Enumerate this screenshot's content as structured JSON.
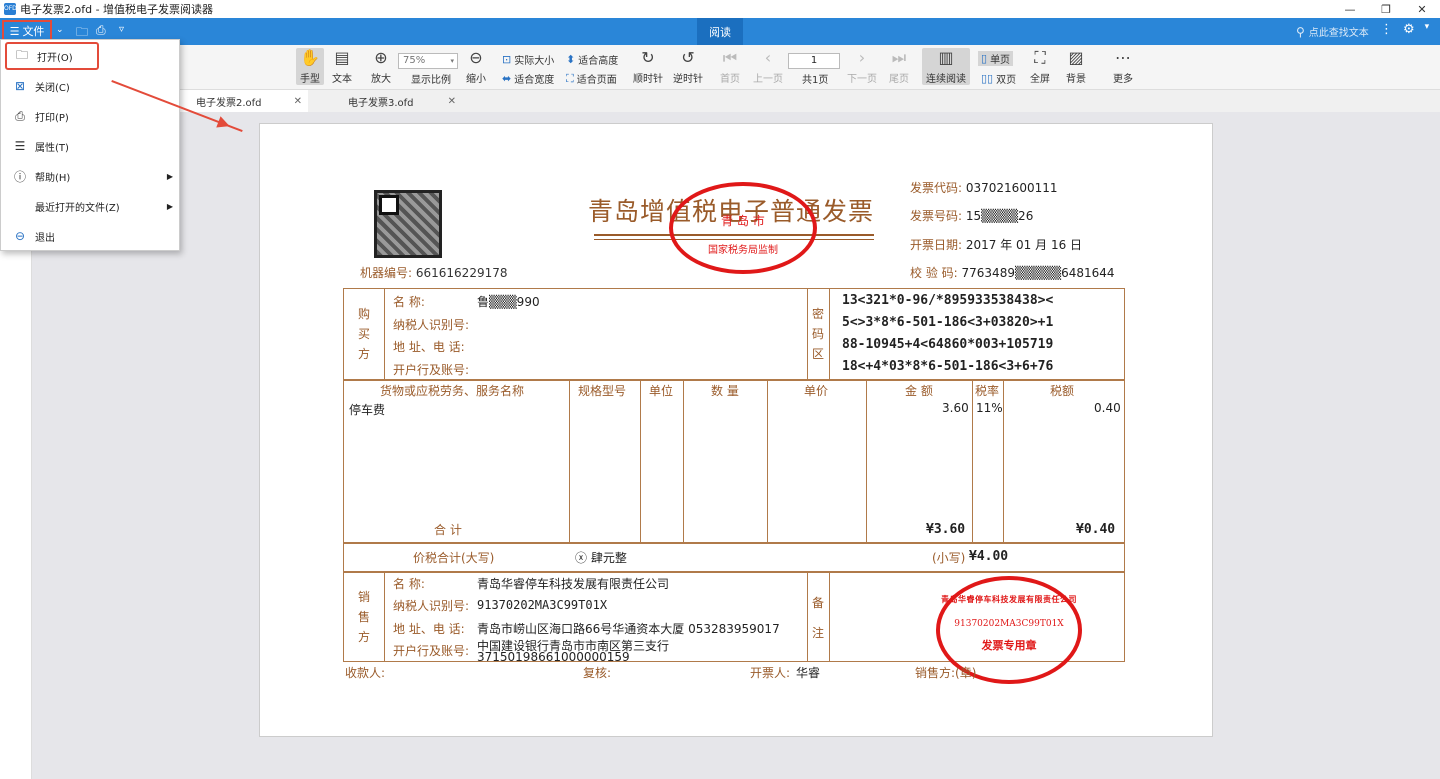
{
  "window": {
    "title": "电子发票2.ofd - 增值税电子发票阅读器",
    "app_icon": "ofd-icon"
  },
  "menubar": {
    "file": "文件",
    "mode_tab": "阅读",
    "search_placeholder": "点此查找文本"
  },
  "toolbar": {
    "hand": "手型",
    "text": "文本",
    "zoom_in": "放大",
    "zoom_value": "75%",
    "zoom_label": "显示比例",
    "zoom_out": "缩小",
    "actual_size": "实际大小",
    "fit_height": "适合高度",
    "fit_width": "适合宽度",
    "fit_page": "适合页面",
    "rotate_cw": "顺时针",
    "rotate_ccw": "逆时针",
    "first": "首页",
    "prev": "上一页",
    "page_value": "1",
    "total_pages": "共1页",
    "next": "下一页",
    "last": "尾页",
    "continuous": "连续阅读",
    "single": "单页",
    "double": "双页",
    "fullscreen": "全屏",
    "background": "背景",
    "more": "更多"
  },
  "tabs": [
    {
      "label": "电子发票2.ofd",
      "active": true
    },
    {
      "label": "电子发票3.ofd",
      "active": false
    }
  ],
  "file_menu": [
    {
      "label": "打开(O)",
      "icon": "folder-icon"
    },
    {
      "label": "关闭(C)",
      "icon": "close-icon"
    },
    {
      "label": "打印(P)",
      "icon": "printer-icon"
    },
    {
      "label": "属性(T)",
      "icon": "properties-icon"
    },
    {
      "label": "帮助(H)",
      "icon": "help-icon",
      "submenu": true
    },
    {
      "label": "最近打开的文件(Z)",
      "icon": "",
      "submenu": true
    },
    {
      "label": "退出",
      "icon": "exit-icon"
    }
  ],
  "invoice": {
    "title": "青岛增值税电子普通发票",
    "stamp_top": {
      "line1": "青 岛 市",
      "line2": "国家税务局监制"
    },
    "machine_label": "机器编号:",
    "machine_no": "661616229178",
    "code_label": "发票代码:",
    "code": "037021600111",
    "number_label": "发票号码:",
    "number": "15▒▒▒▒26",
    "date_label": "开票日期:",
    "date": "2017 年 01 月 16 日",
    "check_label": "校 验 码:",
    "check": "7763489▒▒▒▒▒6481644",
    "buyer_side": "购买方",
    "buyer_name_label": "名            称:",
    "buyer_name": "鲁▒▒▒990",
    "buyer_tax_label": "纳税人识别号:",
    "buyer_addr_label": "地 址、电 话:",
    "buyer_bank_label": "开户行及账号:",
    "cipher_side": "密码区",
    "cipher": [
      "13<321*0-96/*895933538438><",
      "5<>3*8*6-501-186<3+03820>+1",
      "88-10945+4<64860*003+105719",
      "18<+4*03*8*6-501-186<3+6+76"
    ],
    "headers": [
      "货物或应税劳务、服务名称",
      "规格型号",
      "单位",
      "数 量",
      "单价",
      "金 额",
      "税率",
      "税额"
    ],
    "item": {
      "name": "停车费",
      "amount": "3.60",
      "rate": "11%",
      "tax": "0.40"
    },
    "total_label": "合    计",
    "total_amount": "¥3.60",
    "total_tax": "¥0.40",
    "grand_label": "价税合计(大写)",
    "grand_upper": "肆元整",
    "grand_small_label": "(小写)",
    "grand_small": "¥4.00",
    "seller_side": "销售方",
    "seller_name_label": "名            称:",
    "seller_name": "青岛华睿停车科技发展有限责任公司",
    "seller_tax_label": "纳税人识别号:",
    "seller_tax": "91370202MA3C99T01X",
    "seller_addr_label": "地 址、电 话:",
    "seller_addr": "青岛市崂山区海口路66号华通资本大厦 053283959017",
    "seller_bank_label": "开户行及账号:",
    "seller_bank1": "中国建设银行青岛市市南区第三支行",
    "seller_bank2": "37150198661000000159",
    "remark_side": "备注",
    "payee_label": "收款人:",
    "review_label": "复核:",
    "drawer_label": "开票人:",
    "drawer": "华睿",
    "seller_label": "销售方:(章)",
    "stamp_seller": {
      "ring": "青岛华睿停车科技发展有限责任公司",
      "id": "91370202MA3C99T01X",
      "bottom": "发票专用章"
    }
  }
}
